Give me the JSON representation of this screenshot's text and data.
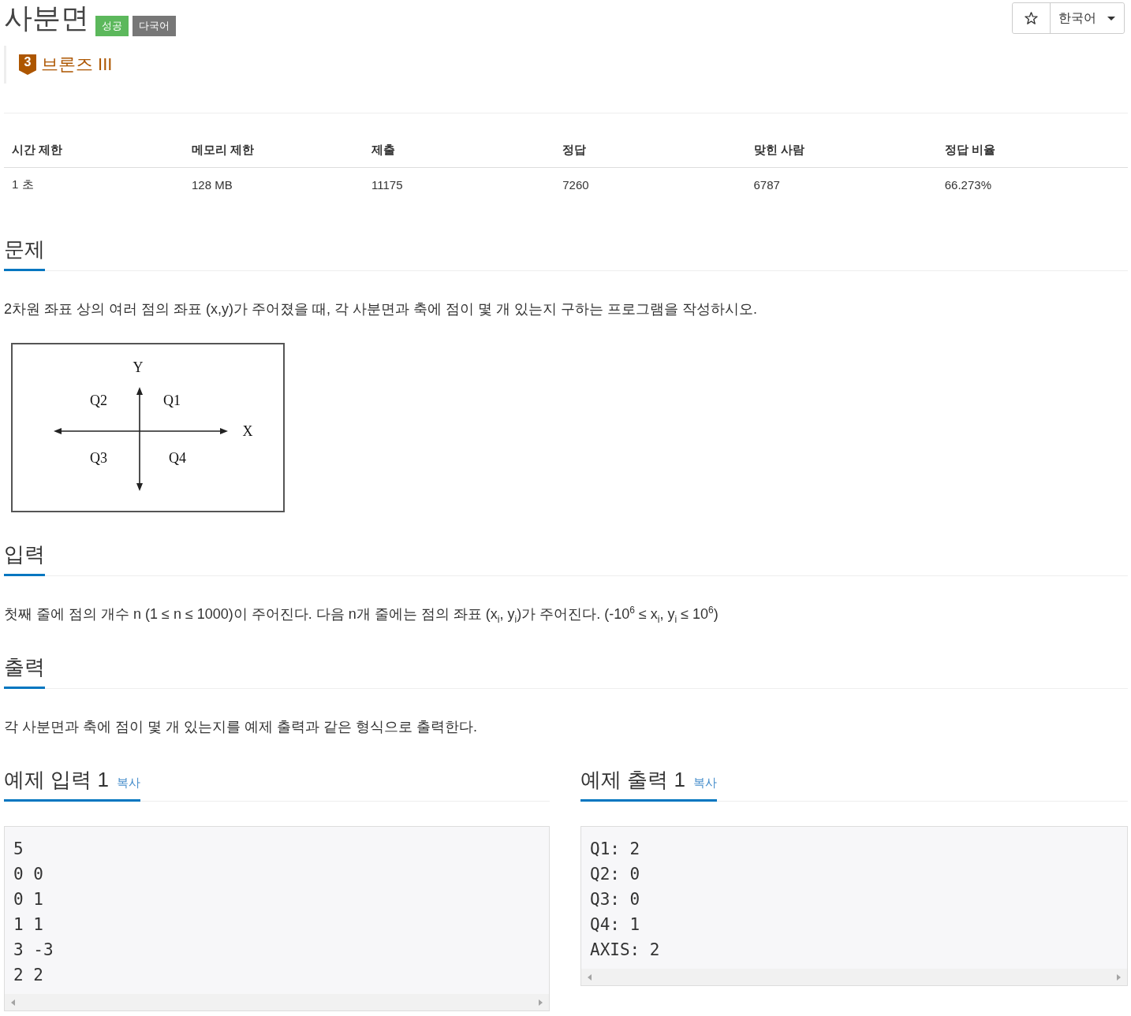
{
  "header": {
    "title": "사분면",
    "badges": [
      {
        "label": "성공",
        "color": "#5cb85c"
      },
      {
        "label": "다국어",
        "color": "#777777"
      }
    ],
    "tier": {
      "level": "3",
      "label": "브론즈 III"
    }
  },
  "toolbar": {
    "starred": false,
    "language": "한국어"
  },
  "stats": {
    "columns": [
      "시간 제한",
      "메모리 제한",
      "제출",
      "정답",
      "맞힌 사람",
      "정답 비율"
    ],
    "rows": [
      [
        "1 초",
        "128 MB",
        "11175",
        "7260",
        "6787",
        "66.273%"
      ]
    ]
  },
  "sections": [
    {
      "title": "문제",
      "text": "2차원 좌표 상의 여러 점의 좌표 (x,y)가 주어졌을 때, 각 사분면과 축에 점이 몇 개 있는지 구하는 프로그램을 작성하시오.",
      "figure": {
        "axis_labels": {
          "y": "Y",
          "x": "X"
        },
        "quadrant_labels": [
          "Q2",
          "Q1",
          "Q3",
          "Q4"
        ]
      }
    },
    {
      "title": "입력",
      "text": "첫째 줄에 점의 개수 n (1 ≤ n ≤ 1000)이 주어진다. 다음 n개 줄에는 점의 좌표 (x$_{i}$, y$_{i}$)가 주어진다. (-10$^{6}$ ≤ x$_{i}$, y$_{i}$ ≤ 10$^{6}$)"
    },
    {
      "title": "출력",
      "text": "각 사분면과 축에 점이 몇 개 있는지를 예제 출력과 같은 형식으로 출력한다."
    }
  ],
  "samples": [
    {
      "title": "예제 입력 1",
      "copy": "복사",
      "lines": [
        "5",
        "0 0",
        "0 1",
        "1 1",
        "3 -3",
        "2 2"
      ]
    },
    {
      "title": "예제 출력 1",
      "copy": "복사",
      "lines": [
        "Q1: 2",
        "Q2: 0",
        "Q3: 0",
        "Q4: 1",
        "AXIS: 2"
      ]
    }
  ]
}
